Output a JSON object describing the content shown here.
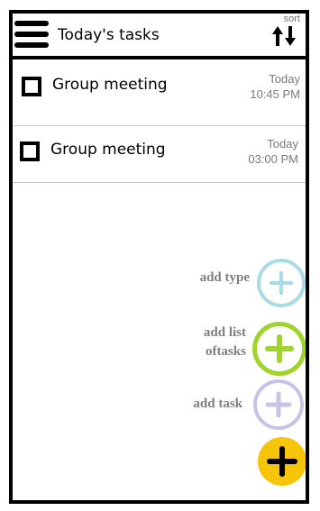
{
  "header": {
    "title": "Today's tasks",
    "sort_label": "sort"
  },
  "tasks": [
    {
      "title": "Group meeting",
      "date": "Today",
      "time": "10:45 PM"
    },
    {
      "title": "Group meeting",
      "date": "Today",
      "time": "03:00 PM"
    }
  ],
  "fab_menu": {
    "add_type_label": "add type",
    "add_list_label_line1": "add list",
    "add_list_label_line2": "oftasks",
    "add_task_label": "add task"
  },
  "colors": {
    "add_type": "#a8dbe6",
    "add_list": "#9fd42f",
    "add_task": "#c9c2e6",
    "main_fab": "#f6c50a"
  },
  "icons": {
    "menu": "hamburger-menu-icon",
    "sort": "sort-arrows-icon",
    "checkbox": "checkbox-icon",
    "plus": "plus-icon"
  }
}
